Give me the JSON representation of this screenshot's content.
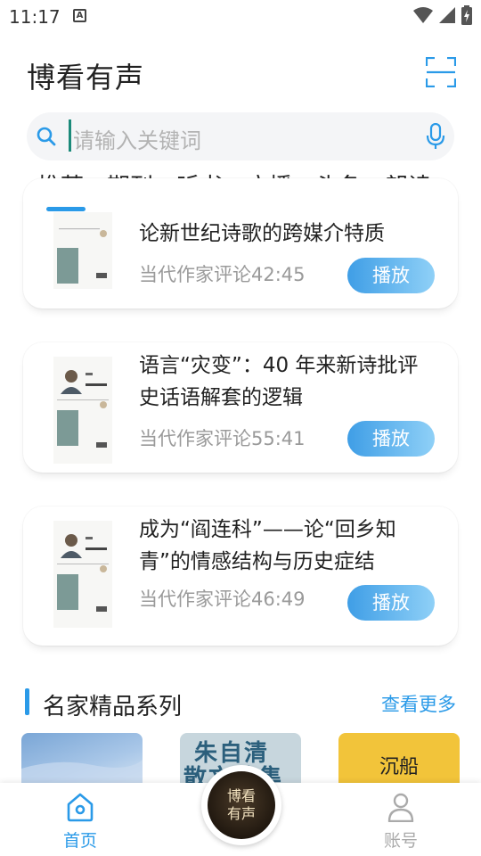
{
  "status": {
    "time": "11:17",
    "a_badge": "A"
  },
  "header": {
    "title": "博看有声",
    "scan_icon": "scan-icon"
  },
  "search": {
    "placeholder": "请输入关键词",
    "icon": "search-icon",
    "mic_icon": "mic-icon"
  },
  "tabs": [
    "推荐",
    "期刊",
    "听书",
    "广播",
    "头条",
    "朗读"
  ],
  "cards": [
    {
      "title": "论新世纪诗歌的跨媒介特质",
      "source": "当代作家评论",
      "duration": "42:45",
      "play_label": "播放"
    },
    {
      "title": "语言“灾变”：40 年来新诗批评史话语解套的逻辑",
      "source": "当代作家评论",
      "duration": "55:41",
      "play_label": "播放"
    },
    {
      "title": "成为“阎连科”——论“回乡知青”的情感结构与历史症结",
      "source": "当代作家评论",
      "duration": "46:49",
      "play_label": "播放"
    }
  ],
  "section": {
    "title": "名家精品系列",
    "more": "查看更多"
  },
  "thumbs": [
    {
      "text": ""
    },
    {
      "text_line1": "朱自清",
      "text_line2": "散文选集"
    },
    {
      "text": "沉船"
    }
  ],
  "bottom_nav": {
    "home": "首页",
    "account": "账号",
    "center_line1": "博看",
    "center_line2": "有声"
  },
  "colors": {
    "accent": "#2a9ae8",
    "cursor": "#1b8a7a"
  }
}
